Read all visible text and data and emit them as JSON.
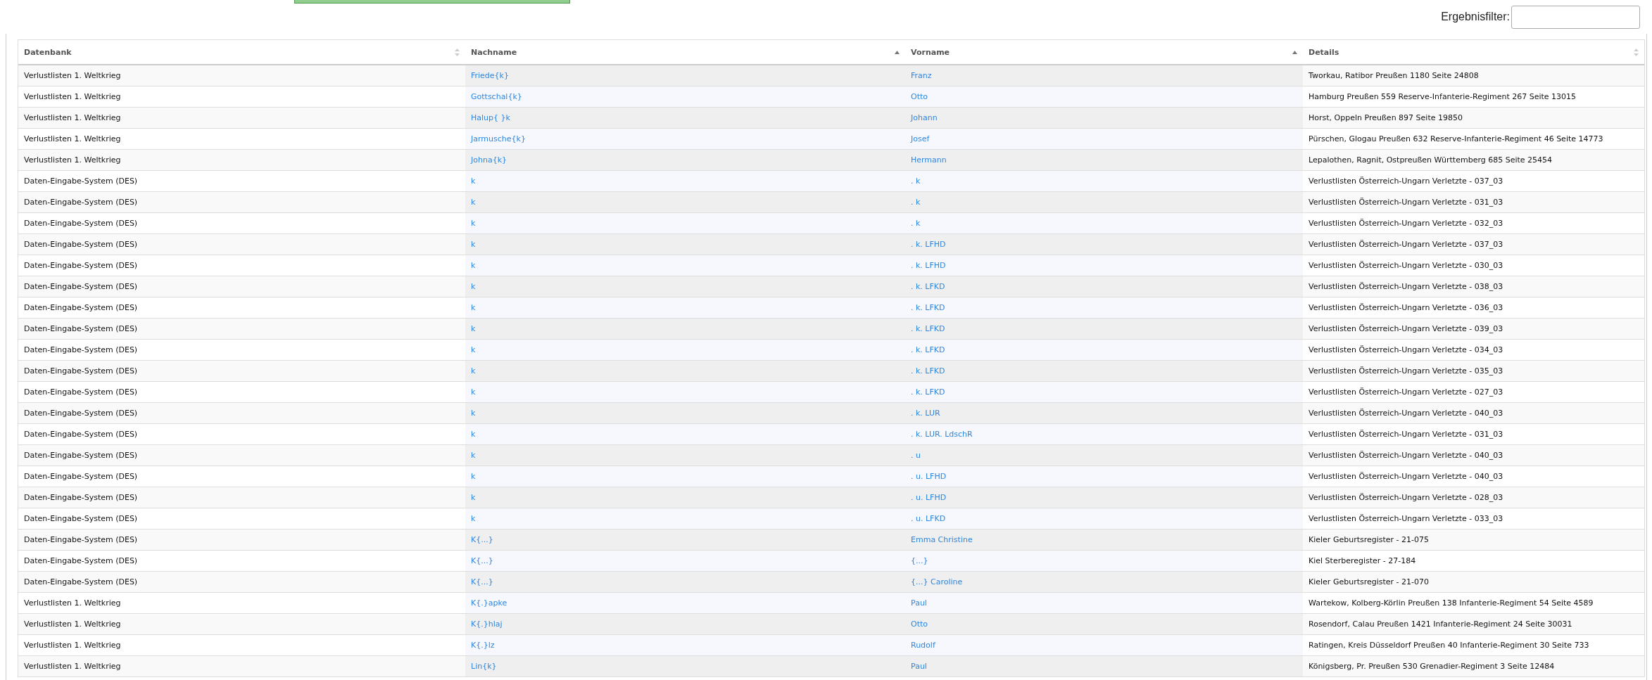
{
  "filter": {
    "label": "Ergebnisfilter:"
  },
  "table": {
    "columns": [
      {
        "label": "Datenbank",
        "sorted": false
      },
      {
        "label": "Nachname",
        "sorted": true
      },
      {
        "label": "Vorname",
        "sorted": true
      },
      {
        "label": "Details",
        "sorted": false
      }
    ],
    "rows": [
      {
        "database": "Verlustlisten 1. Weltkrieg",
        "surname": "Friede{k}",
        "given_name": "Franz",
        "details": "Tworkau, Ratibor Preußen 1180 Seite 24808"
      },
      {
        "database": "Verlustlisten 1. Weltkrieg",
        "surname": "Gottschal{k}",
        "given_name": "Otto",
        "details": "Hamburg Preußen 559 Reserve-Infanterie-Regiment 267 Seite 13015"
      },
      {
        "database": "Verlustlisten 1. Weltkrieg",
        "surname": "Halup{ }k",
        "given_name": "Johann",
        "details": "Horst, Oppeln Preußen 897 Seite 19850"
      },
      {
        "database": "Verlustlisten 1. Weltkrieg",
        "surname": "Jarmusche{k}",
        "given_name": "Josef",
        "details": "Pürschen, Glogau Preußen 632 Reserve-Infanterie-Regiment 46 Seite 14773"
      },
      {
        "database": "Verlustlisten 1. Weltkrieg",
        "surname": "Johna{k}",
        "given_name": "Hermann",
        "details": "Lepalothen, Ragnit, Ostpreußen Württemberg 685 Seite 25454"
      },
      {
        "database": "Daten-Eingabe-System (DES)",
        "surname": "k",
        "given_name": ". k",
        "details": "Verlustlisten Österreich-Ungarn Verletzte - 037_03"
      },
      {
        "database": "Daten-Eingabe-System (DES)",
        "surname": "k",
        "given_name": ". k",
        "details": "Verlustlisten Österreich-Ungarn Verletzte - 031_03"
      },
      {
        "database": "Daten-Eingabe-System (DES)",
        "surname": "k",
        "given_name": ". k",
        "details": "Verlustlisten Österreich-Ungarn Verletzte - 032_03"
      },
      {
        "database": "Daten-Eingabe-System (DES)",
        "surname": "k",
        "given_name": ". k. LFHD",
        "details": "Verlustlisten Österreich-Ungarn Verletzte - 037_03"
      },
      {
        "database": "Daten-Eingabe-System (DES)",
        "surname": "k",
        "given_name": ". k. LFHD",
        "details": "Verlustlisten Österreich-Ungarn Verletzte - 030_03"
      },
      {
        "database": "Daten-Eingabe-System (DES)",
        "surname": "k",
        "given_name": ". k. LFKD",
        "details": "Verlustlisten Österreich-Ungarn Verletzte - 038_03"
      },
      {
        "database": "Daten-Eingabe-System (DES)",
        "surname": "k",
        "given_name": ". k. LFKD",
        "details": "Verlustlisten Österreich-Ungarn Verletzte - 036_03"
      },
      {
        "database": "Daten-Eingabe-System (DES)",
        "surname": "k",
        "given_name": ". k. LFKD",
        "details": "Verlustlisten Österreich-Ungarn Verletzte - 039_03"
      },
      {
        "database": "Daten-Eingabe-System (DES)",
        "surname": "k",
        "given_name": ". k. LFKD",
        "details": "Verlustlisten Österreich-Ungarn Verletzte - 034_03"
      },
      {
        "database": "Daten-Eingabe-System (DES)",
        "surname": "k",
        "given_name": ". k. LFKD",
        "details": "Verlustlisten Österreich-Ungarn Verletzte - 035_03"
      },
      {
        "database": "Daten-Eingabe-System (DES)",
        "surname": "k",
        "given_name": ". k. LFKD",
        "details": "Verlustlisten Österreich-Ungarn Verletzte - 027_03"
      },
      {
        "database": "Daten-Eingabe-System (DES)",
        "surname": "k",
        "given_name": ". k. LUR",
        "details": "Verlustlisten Österreich-Ungarn Verletzte - 040_03"
      },
      {
        "database": "Daten-Eingabe-System (DES)",
        "surname": "k",
        "given_name": ". k. LUR. LdschR",
        "details": "Verlustlisten Österreich-Ungarn Verletzte - 031_03"
      },
      {
        "database": "Daten-Eingabe-System (DES)",
        "surname": "k",
        "given_name": ". u",
        "details": "Verlustlisten Österreich-Ungarn Verletzte - 040_03"
      },
      {
        "database": "Daten-Eingabe-System (DES)",
        "surname": "k",
        "given_name": ". u. LFHD",
        "details": "Verlustlisten Österreich-Ungarn Verletzte - 040_03"
      },
      {
        "database": "Daten-Eingabe-System (DES)",
        "surname": "k",
        "given_name": ". u. LFHD",
        "details": "Verlustlisten Österreich-Ungarn Verletzte - 028_03"
      },
      {
        "database": "Daten-Eingabe-System (DES)",
        "surname": "k",
        "given_name": ". u. LFKD",
        "details": "Verlustlisten Österreich-Ungarn Verletzte - 033_03"
      },
      {
        "database": "Daten-Eingabe-System (DES)",
        "surname": "K{...}",
        "given_name": "Emma Christine",
        "details": "Kieler Geburtsregister - 21-075"
      },
      {
        "database": "Daten-Eingabe-System (DES)",
        "surname": "K{...}",
        "given_name": "{...}",
        "details": "Kiel Sterberegister - 27-184"
      },
      {
        "database": "Daten-Eingabe-System (DES)",
        "surname": "K{...}",
        "given_name": "{...} Caroline",
        "details": "Kieler Geburtsregister - 21-070"
      },
      {
        "database": "Verlustlisten 1. Weltkrieg",
        "surname": "K{.}apke",
        "given_name": "Paul",
        "details": "Wartekow, Kolberg-Körlin Preußen 138 Infanterie-Regiment 54 Seite 4589"
      },
      {
        "database": "Verlustlisten 1. Weltkrieg",
        "surname": "K{.}hlaj",
        "given_name": "Otto",
        "details": "Rosendorf, Calau Preußen 1421 Infanterie-Regiment 24 Seite 30031"
      },
      {
        "database": "Verlustlisten 1. Weltkrieg",
        "surname": "K{.}lz",
        "given_name": "Rudolf",
        "details": "Ratingen, Kreis Düsseldorf Preußen 40 Infanterie-Regiment 30 Seite 733"
      },
      {
        "database": "Verlustlisten 1. Weltkrieg",
        "surname": "Lin{k}",
        "given_name": "Paul",
        "details": "Königsberg, Pr. Preußen 530 Grenadier-Regiment 3 Seite 12484"
      }
    ]
  }
}
